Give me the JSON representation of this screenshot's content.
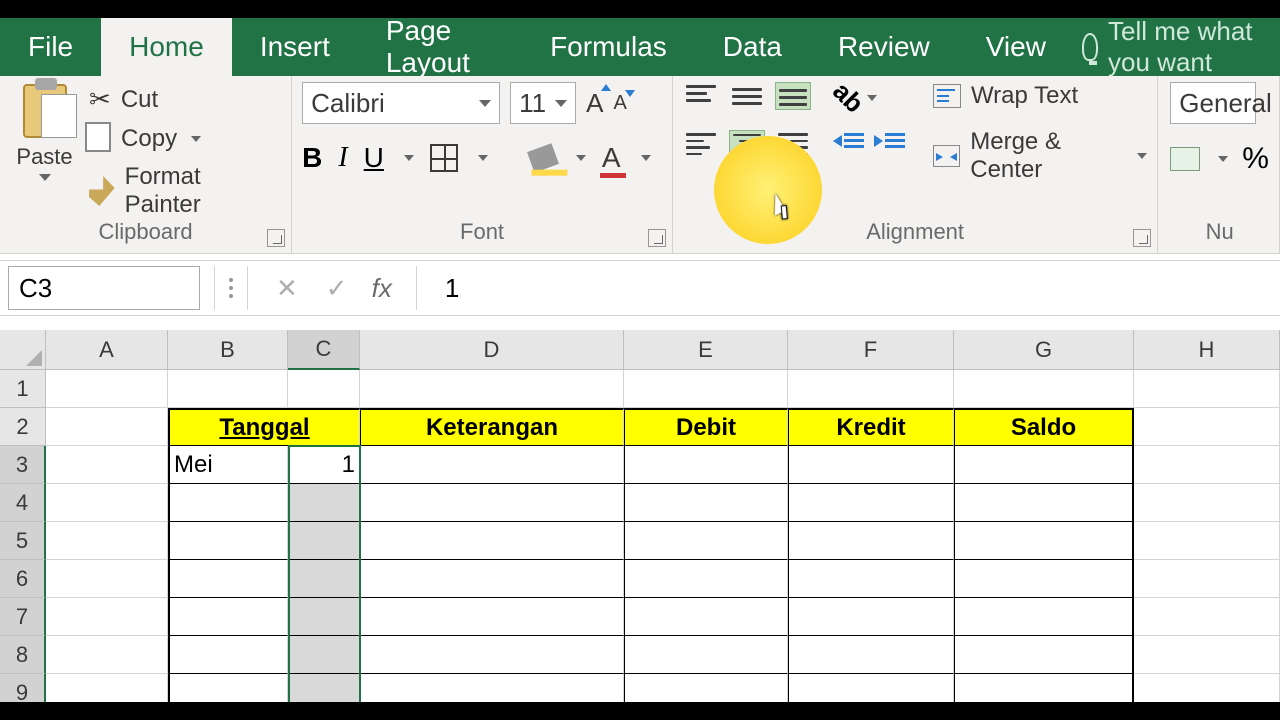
{
  "tabs": {
    "file": "File",
    "home": "Home",
    "insert": "Insert",
    "page_layout": "Page Layout",
    "formulas": "Formulas",
    "data": "Data",
    "review": "Review",
    "view": "View",
    "tell_me": "Tell me what you want"
  },
  "clipboard": {
    "paste": "Paste",
    "cut": "Cut",
    "copy": "Copy",
    "format_painter": "Format Painter",
    "group": "Clipboard"
  },
  "font": {
    "name": "Calibri",
    "size": "11",
    "bold": "B",
    "italic": "I",
    "underline": "U",
    "grow": "A",
    "shrink": "A",
    "color_letter": "A",
    "group": "Font"
  },
  "alignment": {
    "wrap": "Wrap Text",
    "merge": "Merge & Center",
    "orient": "ab",
    "group": "Alignment"
  },
  "number": {
    "format": "General",
    "percent": "%",
    "group": "Nu"
  },
  "namebox": "C3",
  "fx": "fx",
  "formula_value": "1",
  "columns": [
    "A",
    "B",
    "C",
    "D",
    "E",
    "F",
    "G",
    "H"
  ],
  "rows": [
    "1",
    "2",
    "3",
    "4",
    "5",
    "6",
    "7",
    "8",
    "9"
  ],
  "headers": {
    "tanggal": "Tanggal",
    "keterangan": "Keterangan",
    "debit": "Debit",
    "kredit": "Kredit",
    "saldo": "Saldo"
  },
  "cells": {
    "B3": "Mei",
    "C3": "1"
  },
  "colors": {
    "ribbon_green": "#217346",
    "header_yellow": "#ffff00",
    "highlight": "#fdd835"
  },
  "chart_data": {
    "type": "table",
    "title": "",
    "columns": [
      "Tanggal",
      "",
      "Keterangan",
      "Debit",
      "Kredit",
      "Saldo"
    ],
    "rows": [
      [
        "Mei",
        1,
        "",
        "",
        "",
        ""
      ]
    ]
  }
}
